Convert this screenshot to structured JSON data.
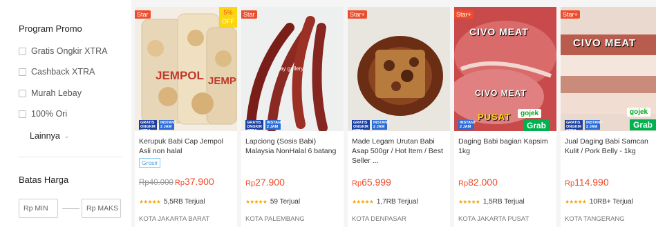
{
  "sidebar": {
    "promo_title": "Program Promo",
    "promo_options": [
      "Gratis Ongkir XTRA",
      "Cashback XTRA",
      "Murah Lebay",
      "100% Ori"
    ],
    "more_label": "Lainnya",
    "price_title": "Batas Harga",
    "min_placeholder": "Rp MIN",
    "max_placeholder": "Rp MAKS"
  },
  "products": [
    {
      "badge": "Star",
      "discount": "5%",
      "discount_off": "OFF",
      "image_text": "JEMPOL",
      "ship_a": "GRATIS ONGKIR XTRA",
      "ship_b": "INSTANT 2 JAM",
      "name": "Kerupuk Babi Cap Jempol Asli non halal",
      "tag": "Grosir",
      "old_price": "Rp40.000",
      "price_currency": "Rp",
      "price": "37.900",
      "stars": "★★★★★",
      "sold": "5,5RB Terjual",
      "location": "KOTA JAKARTA BARAT"
    },
    {
      "badge": "Star",
      "image_text": "ay gallery",
      "ship_a": "GRATIS ONGKIR XTRA",
      "ship_b": "INSTANT 2 JAM",
      "name": "Lapciong (Sosis Babi) Malaysia NonHalal 6 batang",
      "price_currency": "Rp",
      "price": "27.900",
      "stars": "★★★★★",
      "sold": "59 Terjual",
      "location": "KOTA PALEMBANG"
    },
    {
      "badge": "Star+",
      "ship_a": "GRATIS ONGKIR XTRA",
      "ship_b": "INSTANT 2 JAM",
      "name": "Made Legam Urutan Babi Asap 500gr / Hot Item / Best Seller ...",
      "price_currency": "Rp",
      "price": "65.999",
      "stars": "★★★★★",
      "sold": "1,7RB Terjual",
      "location": "KOTA DENPASAR"
    },
    {
      "badge": "Star+",
      "logo_top": "CIVO MEAT",
      "logo_bottom": "CIVO MEAT",
      "gojek": "gojek",
      "grab": "Grab",
      "pusat": "PUSAT",
      "ship_b": "INSTANT 2 JAM",
      "name": "Daging Babi bagian Kapsim 1kg",
      "price_currency": "Rp",
      "price": "82.000",
      "stars": "★★★★★",
      "sold": "1,5RB Terjual",
      "location": "KOTA JAKARTA PUSAT"
    },
    {
      "badge": "Star+",
      "logo_top": "CIVO MEAT",
      "gojek": "gojek",
      "grab": "Grab",
      "ship_a": "GRATIS ONGKIR XTRA",
      "ship_b": "INSTANT 2 JAM",
      "name": "Jual Daging Babi Samcan Kulit / Pork Belly - 1kg",
      "price_currency": "Rp",
      "price": "114.990",
      "stars": "★★★★★",
      "sold": "10RB+ Terjual",
      "location": "KOTA TANGERANG"
    }
  ],
  "colors": {
    "accent": "#ee4d2d",
    "star": "#f6a700",
    "badge_off": "#fcd511"
  }
}
